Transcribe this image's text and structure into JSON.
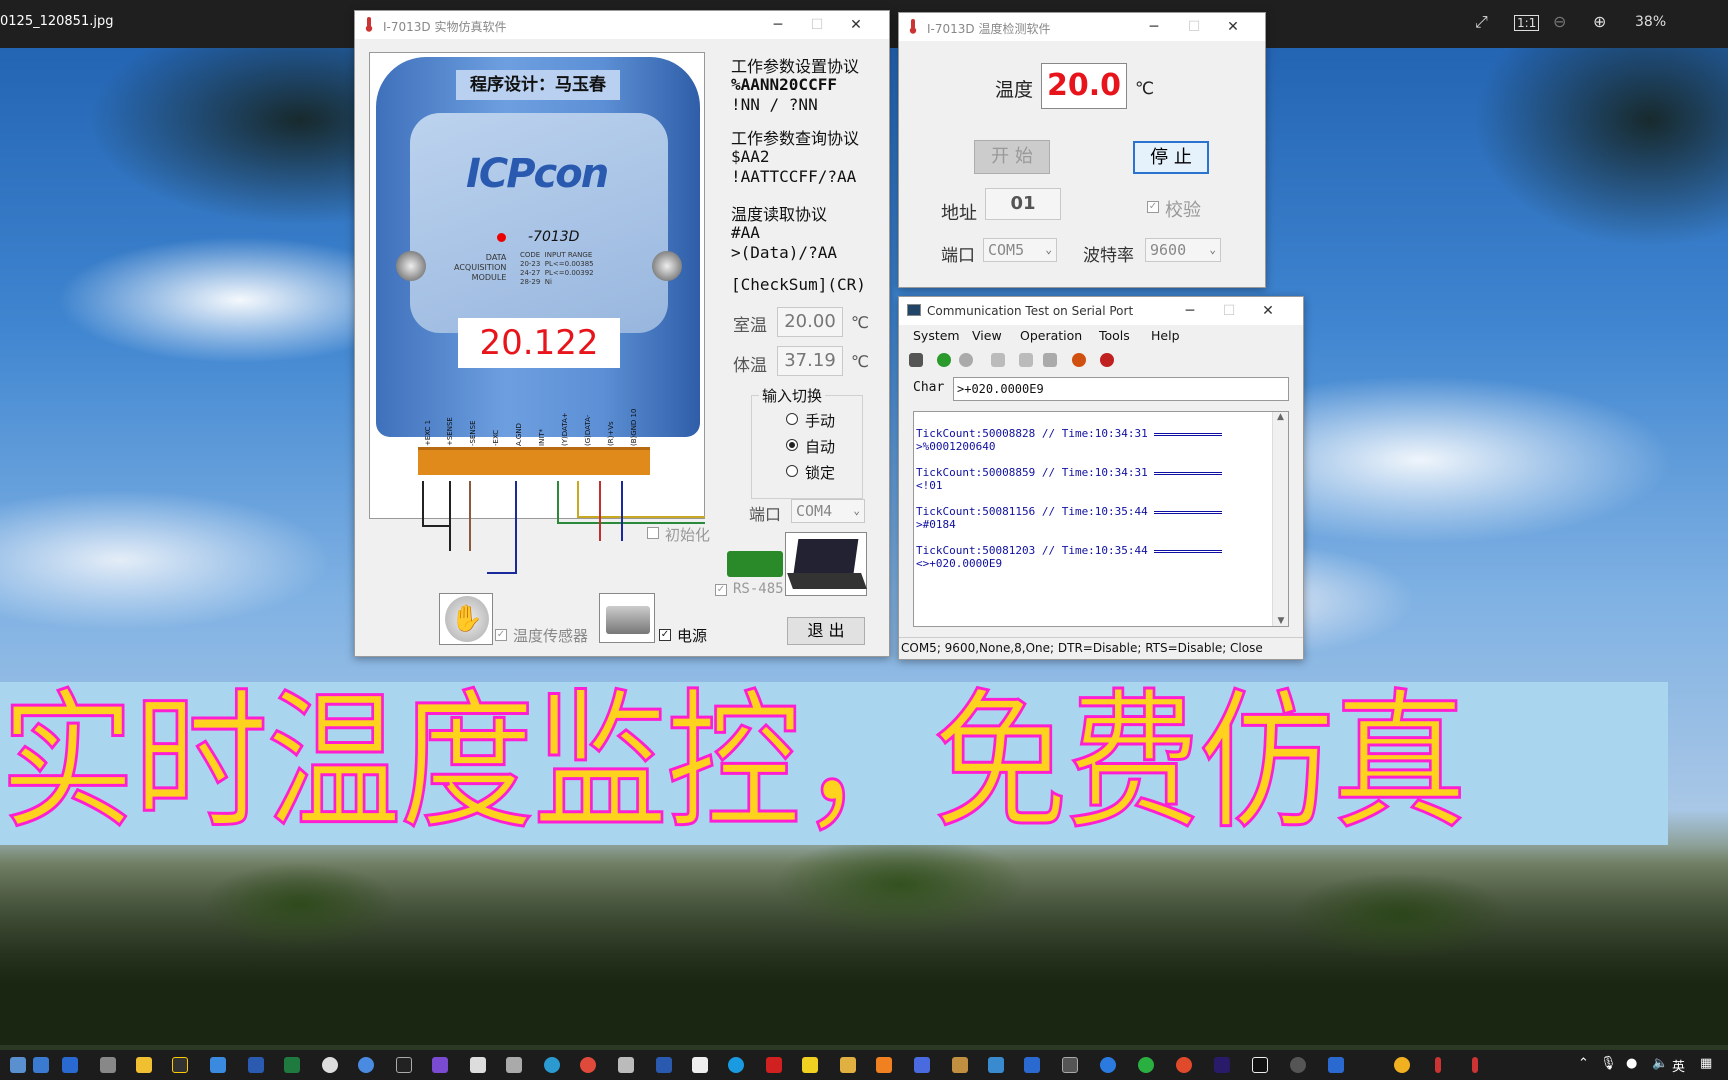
{
  "viewer": {
    "filename": "0125_120851.jpg",
    "zoom": "38%"
  },
  "banner": {
    "text": "实时温度监控，免费仿真"
  },
  "win1": {
    "title": "I-7013D 实物仿真软件",
    "designer": "程序设计：马玉春",
    "display": "20.122",
    "device_brand": "ICPcon",
    "device_model": "-7013D",
    "device_text": [
      "DATA",
      "ACQUISITION",
      "MODULE"
    ],
    "table_headers": [
      "CODE",
      "INPUT RANGE"
    ],
    "table_rows": [
      [
        "20-23",
        "PL<=0.00385"
      ],
      [
        "24-27",
        "PL<=0.00392"
      ],
      [
        "28-29",
        "Ni"
      ]
    ],
    "pins": [
      "+EXC 1",
      "+SENSE",
      "-SENSE",
      "-EXC",
      "A.GND",
      "INIT*",
      "(Y)DATA+",
      "(G)DATA-",
      "(R)+Vs",
      "(B)GND 10"
    ],
    "set_title": "工作参数设置协议",
    "set_cmd1": "%AANN20CCFF",
    "set_cmd2": "!NN / ?NN",
    "query_title": "工作参数查询协议",
    "query_cmd1": "$AA2",
    "query_cmd2": "!AATTCCFF/?AA",
    "read_title": "温度读取协议",
    "read_cmd1": "#AA",
    "read_cmd2": ">(Data)/?AA",
    "checksum": "[CheckSum](CR)",
    "room_label": "室温",
    "room_value": "20.00",
    "room_unit": "℃",
    "body_label": "体温",
    "body_value": "37.19",
    "body_unit": "℃",
    "switch_group": "输入切换",
    "radio_manual": "手动",
    "radio_auto": "自动",
    "radio_lock": "锁定",
    "port_label": "端口",
    "port_value": "COM4",
    "init_label": "初始化",
    "rs485_label": "RS-485",
    "sensor_label": "温度传感器",
    "power_label": "电源",
    "exit_button": "退 出"
  },
  "win2": {
    "title": "I-7013D 温度检测软件",
    "temp_label": "温度",
    "temp_value": "20.0",
    "temp_unit": "℃",
    "start_button": "开 始",
    "stop_button": "停 止",
    "addr_label": "地址",
    "addr_value": "01",
    "verify_label": "校验",
    "port_label": "端口",
    "port_value": "COM5",
    "baud_label": "波特率",
    "baud_value": "9600"
  },
  "win3": {
    "title": "Communication Test on Serial Port",
    "menu": [
      "System",
      "View",
      "Operation",
      "Tools",
      "Help"
    ],
    "char_label": "Char",
    "char_value": ">+020.0000E9",
    "log": [
      {
        "tick": "TickCount:50008828 // Time:10:34:31",
        "msg": ">%0001200640"
      },
      {
        "tick": "TickCount:50008859 // Time:10:34:31",
        "msg": "<!01"
      },
      {
        "tick": "TickCount:50081156 // Time:10:35:44",
        "msg": ">#0184"
      },
      {
        "tick": "TickCount:50081203 // Time:10:35:44",
        "msg": "<>+020.0000E9"
      }
    ],
    "status": "COM5; 9600,None,8,One; DTR=Disable; RTS=Disable; Close"
  },
  "tray": {
    "lang": "英"
  },
  "colors": {
    "display_red": "#e8141c",
    "banner_fill": "#ffd21e",
    "banner_stroke": "#ff1fd2",
    "banner_bg": "#a9d5ef",
    "device_blue": "#5b8fd6",
    "log_blue": "#1010a0"
  }
}
